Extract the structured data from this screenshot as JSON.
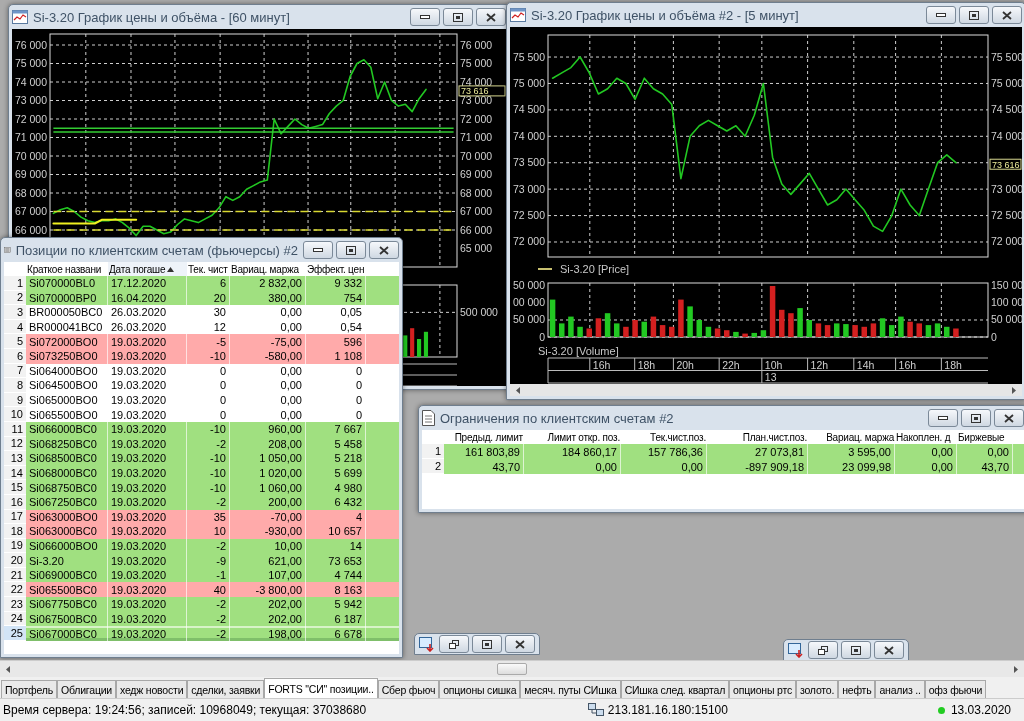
{
  "chart_window_60": {
    "title": "Si-3.20 График цены и объёма - [60 минут]",
    "price_pane": {
      "last_price": "73 616",
      "chart_data": {
        "type": "line",
        "ylim": [
          64000,
          76595
        ],
        "y2lim": [
          64000,
          76595
        ],
        "grid": true,
        "yticks": [
          {
            "value": 76000,
            "label": "76 000"
          },
          {
            "value": 75000,
            "label": "75 000"
          },
          {
            "value": 74000,
            "label": "74 000"
          },
          {
            "value": 73000,
            "label": "73 000"
          },
          {
            "value": 72000,
            "label": "72 000"
          },
          {
            "value": 71000,
            "label": "71 000"
          },
          {
            "value": 70000,
            "label": "70 000"
          },
          {
            "value": 69000,
            "label": "69 000"
          },
          {
            "value": 68000,
            "label": "68 000"
          },
          {
            "value": 67000,
            "label": "67 000"
          },
          {
            "value": 66000,
            "label": "66 000"
          }
        ],
        "y2ticks": [
          {
            "value": 76000,
            "label": "76 000"
          },
          {
            "value": 75000,
            "label": "75 000"
          },
          {
            "value": 74000,
            "label": "74 000"
          },
          {
            "value": 73000,
            "label": "73 000"
          },
          {
            "value": 72000,
            "label": "72 000"
          },
          {
            "value": 71000,
            "label": "71 000"
          },
          {
            "value": 70000,
            "label": "70 000"
          },
          {
            "value": 69000,
            "label": "69 000"
          },
          {
            "value": 68000,
            "label": "68 000"
          },
          {
            "value": 67000,
            "label": "67 000"
          },
          {
            "value": 66000,
            "label": "66 000"
          },
          {
            "value": 65000,
            "label": "65 000"
          }
        ],
        "series": [
          {
            "color": "#22c822",
            "values": [
              66900,
              67100,
              67200,
              67000,
              66700,
              66500,
              66400,
              66500,
              66500,
              66600,
              66400,
              66100,
              65700,
              66200,
              66200,
              66000,
              65800,
              65900,
              66300,
              66600,
              66500,
              66400,
              66600,
              66800,
              67200,
              67800,
              67600,
              67800,
              68200,
              68400,
              68600,
              68700,
              72000,
              71200,
              71600,
              72000,
              71700,
              71500,
              71600,
              71700,
              72300,
              72700,
              73000,
              74300,
              75000,
              75200,
              74800,
              73100,
              74000,
              73000,
              72700,
              72800,
              72400,
              73100,
              73600,
              null,
              null,
              null,
              null
            ]
          },
          {
            "color": "#f0f020",
            "values": [
              66350,
              66350,
              66350,
              66350,
              66350,
              66350,
              66350,
              66550,
              66550,
              66550,
              66550,
              66550,
              66550,
              null,
              null,
              null,
              null,
              null,
              null,
              null,
              null,
              null,
              null,
              null,
              null,
              null,
              null,
              null,
              null,
              null,
              null,
              null,
              null,
              null,
              null,
              null,
              null,
              null,
              null,
              null,
              null,
              null,
              null,
              null,
              null,
              null,
              null,
              null,
              null,
              null,
              null,
              null,
              null,
              null,
              null,
              null,
              null,
              null,
              null
            ]
          },
          {
            "color": "#33cc33",
            "values": [
              71500,
              71500,
              71500,
              71500,
              71500,
              71500,
              71500,
              71500,
              71500,
              71500,
              71500,
              71500,
              71500,
              71500,
              71500,
              71500,
              71500,
              71500,
              71500,
              71500,
              71500,
              71500,
              71500,
              71500,
              71500,
              71500,
              71500,
              71500,
              71500,
              71500,
              71500,
              71500,
              71500,
              71500,
              71500,
              71500,
              71500,
              71500,
              71500,
              71500,
              71500,
              71500,
              71500,
              71500,
              71500,
              71500,
              71500,
              71500,
              71500,
              71500,
              71500,
              71500,
              71500,
              71500,
              71500,
              71500,
              71500,
              71500,
              71500
            ]
          },
          {
            "color": "#33cc33",
            "values": [
              71300,
              71300,
              71300,
              71300,
              71300,
              71300,
              71300,
              71300,
              71300,
              71300,
              71300,
              71300,
              71300,
              71300,
              71300,
              71300,
              71300,
              71300,
              71300,
              71300,
              71300,
              71300,
              71300,
              71300,
              71300,
              71300,
              71300,
              71300,
              71300,
              71300,
              71300,
              71300,
              71300,
              71300,
              71300,
              71300,
              71300,
              71300,
              71300,
              71300,
              71300,
              71300,
              71300,
              71300,
              71300,
              71300,
              71300,
              71300,
              71300,
              71300,
              71300,
              71300,
              71300,
              71300,
              71300,
              71300,
              71300,
              71300,
              71300
            ]
          },
          {
            "color": "#d8d830",
            "line_style": "dashed",
            "values": [
              67000,
              67000,
              67000,
              67000,
              67000,
              67000,
              67000,
              67000,
              67000,
              67000,
              67000,
              67000,
              67000,
              67000,
              67000,
              67000,
              67000,
              67000,
              67000,
              67000,
              67000,
              67000,
              67000,
              67000,
              67000,
              67000,
              67000,
              67000,
              67000,
              67000,
              67000,
              67000,
              67000,
              67000,
              67000,
              67000,
              67000,
              67000,
              67000,
              67000,
              67000,
              67000,
              67000,
              67000,
              67000,
              67000,
              67000,
              67000,
              67000,
              67000,
              67000,
              67000,
              67000,
              67000,
              67000,
              67000,
              67000,
              67000,
              67000
            ]
          },
          {
            "color": "#d8d830",
            "line_style": "dashed",
            "values": [
              66000,
              66000,
              66000,
              66000,
              66000,
              66000,
              66000,
              66000,
              66000,
              66000,
              66000,
              66000,
              66000,
              66000,
              66000,
              66000,
              66000,
              66000,
              66000,
              66000,
              66000,
              66000,
              66000,
              66000,
              66000,
              66000,
              66000,
              66000,
              66000,
              66000,
              66000,
              66000,
              66000,
              66000,
              66000,
              66000,
              66000,
              66000,
              66000,
              66000,
              66000,
              66000,
              66000,
              66000,
              66000,
              66000,
              66000,
              66000,
              66000,
              66000,
              66000,
              66000,
              66000,
              66000,
              66000,
              66000,
              66000,
              66000,
              66000
            ]
          }
        ]
      }
    },
    "volume_pane": {
      "scale_label": "500 000"
    }
  },
  "chart_window_5": {
    "title": "Si-3.20 График цены и объёма #2 - [5 минут]",
    "price_pane": {
      "last_price": "73 616",
      "chart_data": {
        "type": "line",
        "ylim": [
          71716,
          75917
        ],
        "y2lim": [
          71716,
          75917
        ],
        "grid": true,
        "yticks": [
          {
            "value": 75500,
            "label": "75 500"
          },
          {
            "value": 75000,
            "label": "75 000"
          },
          {
            "value": 74500,
            "label": "74 500"
          },
          {
            "value": 74000,
            "label": "74 000"
          },
          {
            "value": 73500,
            "label": "73 500"
          },
          {
            "value": 73000,
            "label": "73 000"
          },
          {
            "value": 72500,
            "label": "72 500"
          },
          {
            "value": 72000,
            "label": "72 000"
          }
        ],
        "y2ticks": [
          {
            "value": 75500,
            "label": "75 500"
          },
          {
            "value": 75000,
            "label": "75 000"
          },
          {
            "value": 74500,
            "label": "74 500"
          },
          {
            "value": 74000,
            "label": "74 000"
          },
          {
            "value": 73000,
            "label": "73 000"
          },
          {
            "value": 72500,
            "label": "72 500"
          },
          {
            "value": 72000,
            "label": "72 000"
          }
        ],
        "series": [
          {
            "name": "Si-3.20 [Price]",
            "color": "#22c822",
            "values": [
              75100,
              75200,
              75300,
              75500,
              75200,
              74800,
              74900,
              75100,
              75000,
              74700,
              75100,
              74900,
              74800,
              74600,
              73200,
              74000,
              74200,
              74300,
              74200,
              74100,
              74200,
              74000,
              74400,
              75000,
              73600,
              73100,
              72900,
              73100,
              73300,
              73000,
              72700,
              72800,
              73000,
              72800,
              72600,
              72300,
              72200,
              72500,
              73000,
              72700,
              72500,
              73000,
              73500,
              73650,
              73500,
              null,
              null,
              null
            ]
          }
        ]
      }
    },
    "volume_pane": {
      "chart_data": {
        "type": "bar",
        "ylim": [
          0,
          158800
        ],
        "y2lim": [
          0,
          158800
        ],
        "grid": true,
        "yticks": [
          {
            "value": 50000,
            "label": "50 000"
          },
          {
            "value": 0,
            "label": "0"
          }
        ],
        "y2ticks": [
          {
            "value": 150000,
            "label": "150 00"
          },
          {
            "value": 100000,
            "label": "100 00"
          },
          {
            "value": 50000,
            "label": "50 000"
          },
          {
            "value": 0,
            "label": "0"
          }
        ],
        "series": [
          {
            "name": "Si-3.20 [Volume]",
            "color": "#22c822",
            "values": [
              110000,
              40000,
              60000,
              30000,
              null,
              null,
              70000,
              40000,
              null,
              null,
              45000,
              null,
              null,
              null,
              null,
              90000,
              50000,
              30000,
              null,
              null,
              15000,
              null,
              12000,
              20000,
              null,
              null,
              null,
              85000,
              50000,
              null,
              null,
              40000,
              38000,
              null,
              null,
              null,
              55000,
              35000,
              60000,
              null,
              null,
              35000,
              40000,
              30000,
              null,
              null,
              null,
              null
            ]
          },
          {
            "color": "#d42020",
            "values": [
              null,
              null,
              null,
              null,
              25000,
              55000,
              null,
              null,
              30000,
              50000,
              null,
              60000,
              35000,
              30000,
              110000,
              null,
              null,
              null,
              25000,
              20000,
              null,
              10000,
              null,
              null,
              150000,
              80000,
              70000,
              null,
              null,
              40000,
              35000,
              null,
              null,
              35000,
              30000,
              40000,
              null,
              null,
              null,
              45000,
              40000,
              null,
              null,
              null,
              25000,
              null,
              null,
              null
            ]
          }
        ]
      },
      "cut_axis_labels": [
        "50 000",
        "00 000"
      ],
      "time_axis": {
        "hours": [
          "16h",
          "18h",
          "20h",
          "22h",
          "10h",
          "12h",
          "14h",
          "16h",
          "18h"
        ],
        "dates": [
          "13"
        ]
      }
    }
  },
  "restrictions_window": {
    "title": "Ограничения по клиентским счетам #2",
    "columns": [
      "Предыд. лимит",
      "Лимит откр. поз.",
      "Тек.чист.поз.",
      "План.чист.поз.",
      "Вариац. маржа",
      "Накоплен. д",
      "Биржевые"
    ],
    "rows": [
      {
        "number": "1",
        "cells": [
          "161 803,89",
          "184 860,17",
          "157 786,36",
          "27 073,81",
          "3 595,00",
          "0,00",
          "0,00"
        ]
      },
      {
        "number": "2",
        "cells": [
          "43,70",
          "0,00",
          "0,00",
          "-897 909,18",
          "23 099,98",
          "0,00",
          "43,70"
        ]
      }
    ]
  },
  "positions_window": {
    "title": "Позиции по клиентским счетам (фьючерсы) #2",
    "columns": [
      {
        "label": "Краткое названи",
        "sorted": false
      },
      {
        "label": "Дата погаше",
        "sorted": true
      },
      {
        "label": "Тек. чист",
        "sorted": false
      },
      {
        "label": "Вариац. маржа",
        "sorted": false
      },
      {
        "label": "Эффект. цен",
        "sorted": false
      }
    ],
    "rows": [
      {
        "number": "1",
        "cells": [
          "Si070000BL0",
          "17.12.2020",
          "6",
          "2 832,00",
          "9 332"
        ],
        "color": "#a0e080",
        "selected": false
      },
      {
        "number": "2",
        "cells": [
          "Si070000BP0",
          "16.04.2020",
          "20",
          "380,00",
          "754"
        ],
        "color": "#a0e080",
        "selected": false
      },
      {
        "number": "3",
        "cells": [
          "BR000050BC0",
          "26.03.2020",
          "30",
          "0,00",
          "0,05"
        ],
        "color": "#ffffff",
        "selected": false
      },
      {
        "number": "4",
        "cells": [
          "BR000041BC0",
          "26.03.2020",
          "12",
          "0,00",
          "0,54"
        ],
        "color": "#ffffff",
        "selected": false
      },
      {
        "number": "5",
        "cells": [
          "Si072000BO0",
          "19.03.2020",
          "-5",
          "-75,00",
          "596"
        ],
        "color": "#ffaaaa",
        "selected": false
      },
      {
        "number": "6",
        "cells": [
          "Si073250BO0",
          "19.03.2020",
          "-10",
          "-580,00",
          "1 108"
        ],
        "color": "#ffaaaa",
        "selected": false
      },
      {
        "number": "7",
        "cells": [
          "Si064000BO0",
          "19.03.2020",
          "0",
          "0,00",
          "0"
        ],
        "color": "#ffffff",
        "selected": false
      },
      {
        "number": "8",
        "cells": [
          "Si064500BO0",
          "19.03.2020",
          "0",
          "0,00",
          "0"
        ],
        "color": "#ffffff",
        "selected": false
      },
      {
        "number": "9",
        "cells": [
          "Si065000BO0",
          "19.03.2020",
          "0",
          "0,00",
          "0"
        ],
        "color": "#ffffff",
        "selected": false
      },
      {
        "number": "10",
        "cells": [
          "Si065500BO0",
          "19.03.2020",
          "0",
          "0,00",
          "0"
        ],
        "color": "#ffffff",
        "selected": false
      },
      {
        "number": "11",
        "cells": [
          "Si066000BC0",
          "19.03.2020",
          "-10",
          "960,00",
          "7 667"
        ],
        "color": "#a0e080",
        "selected": false
      },
      {
        "number": "12",
        "cells": [
          "Si068250BC0",
          "19.03.2020",
          "-2",
          "208,00",
          "5 458"
        ],
        "color": "#a0e080",
        "selected": false
      },
      {
        "number": "13",
        "cells": [
          "Si068500BC0",
          "19.03.2020",
          "-10",
          "1 050,00",
          "5 218"
        ],
        "color": "#a0e080",
        "selected": false
      },
      {
        "number": "14",
        "cells": [
          "Si068000BC0",
          "19.03.2020",
          "-10",
          "1 020,00",
          "5 699"
        ],
        "color": "#a0e080",
        "selected": false
      },
      {
        "number": "15",
        "cells": [
          "Si068750BC0",
          "19.03.2020",
          "-10",
          "1 060,00",
          "4 980"
        ],
        "color": "#a0e080",
        "selected": false
      },
      {
        "number": "16",
        "cells": [
          "Si067250BC0",
          "19.03.2020",
          "-2",
          "200,00",
          "6 432"
        ],
        "color": "#a0e080",
        "selected": false
      },
      {
        "number": "17",
        "cells": [
          "Si063000BO0",
          "19.03.2020",
          "35",
          "-70,00",
          "4"
        ],
        "color": "#ffaaaa",
        "selected": false
      },
      {
        "number": "18",
        "cells": [
          "Si063000BC0",
          "19.03.2020",
          "10",
          "-930,00",
          "10 657"
        ],
        "color": "#ffaaaa",
        "selected": false
      },
      {
        "number": "19",
        "cells": [
          "Si066000BO0",
          "19.03.2020",
          "-2",
          "10,00",
          "14"
        ],
        "color": "#a0e080",
        "selected": false
      },
      {
        "number": "20",
        "cells": [
          "Si-3.20",
          "19.03.2020",
          "-9",
          "621,00",
          "73 653"
        ],
        "color": "#a0e080",
        "selected": false
      },
      {
        "number": "21",
        "cells": [
          "Si069000BC0",
          "19.03.2020",
          "-1",
          "107,00",
          "4 744"
        ],
        "color": "#a0e080",
        "selected": false
      },
      {
        "number": "22",
        "cells": [
          "Si065500BC0",
          "19.03.2020",
          "40",
          "-3 800,00",
          "8 163"
        ],
        "color": "#ffaaaa",
        "selected": false
      },
      {
        "number": "23",
        "cells": [
          "Si067750BC0",
          "19.03.2020",
          "-2",
          "202,00",
          "5 942"
        ],
        "color": "#a0e080",
        "selected": false
      },
      {
        "number": "24",
        "cells": [
          "Si067500BC0",
          "19.03.2020",
          "-2",
          "202,00",
          "6 187"
        ],
        "color": "#a0e080",
        "selected": false
      },
      {
        "number": "25",
        "cells": [
          "Si067000BC0",
          "19.03.2020",
          "-2",
          "198,00",
          "6 678"
        ],
        "color": "#a0e080",
        "selected": true
      }
    ]
  },
  "tabs": [
    {
      "label": "Портфель",
      "selected": false
    },
    {
      "label": "Облигации",
      "selected": false
    },
    {
      "label": "хедж новости",
      "selected": false
    },
    {
      "label": "сделки, заявки",
      "selected": false
    },
    {
      "label": "FORTS \"СИ\" позиции..",
      "selected": true
    },
    {
      "label": "Сбер фьюч",
      "selected": false
    },
    {
      "label": "опционы сишка",
      "selected": false
    },
    {
      "label": "месяч. путы СИшка",
      "selected": false
    },
    {
      "label": "СИшка след. квартал",
      "selected": false
    },
    {
      "label": "опционы ртс",
      "selected": false
    },
    {
      "label": "золото.",
      "selected": false
    },
    {
      "label": "нефть",
      "selected": false
    },
    {
      "label": "анализ ..",
      "selected": false
    },
    {
      "label": "офз фьючи",
      "selected": false
    }
  ],
  "status_bar": {
    "text": "Время сервера: 19:24:56; записей: 10968049; текущая: 37038680",
    "server": "213.181.16.180:15100",
    "online": true,
    "date": "13.03.2020"
  }
}
